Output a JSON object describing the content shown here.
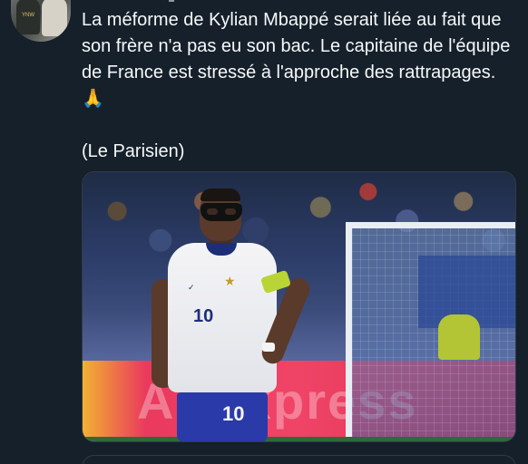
{
  "tweet": {
    "text": "La méforme de Kylian Mbappé serait liée au fait que son frère n'a pas eu son bac. Le capitaine de l'équipe de France est stressé à l'approche des rattrapages. 🙏\n\n(Le Parisien)"
  },
  "avatar": {
    "jersey_text": "YNW"
  },
  "media": {
    "shirt_number": "10",
    "shorts_number": "10",
    "ad_text": "AliExpress"
  },
  "colors": {
    "background": "#15202b",
    "text": "#f7f9f9",
    "border": "#2f3b47"
  }
}
